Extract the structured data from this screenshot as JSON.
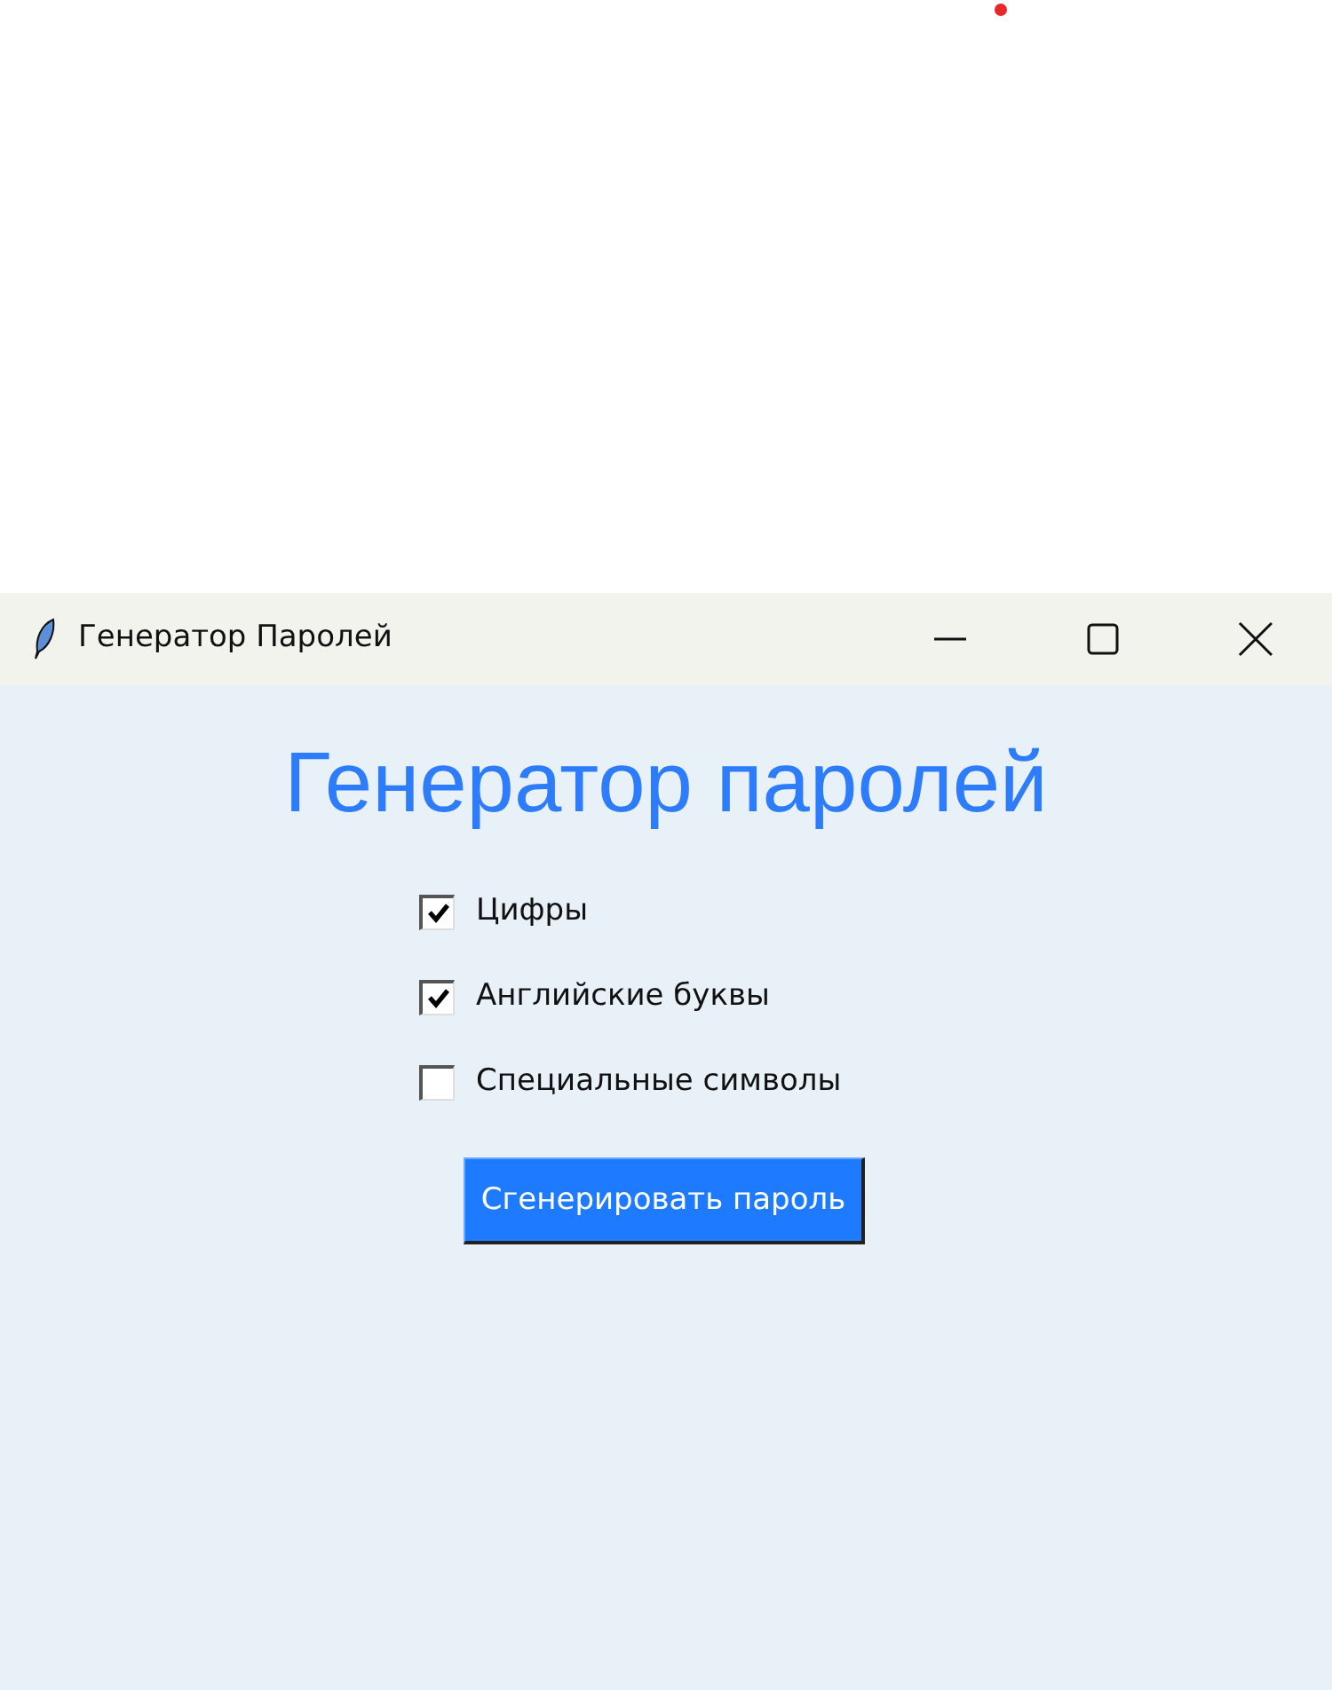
{
  "window": {
    "title": "Генератор Паролей"
  },
  "heading": "Генератор паролей",
  "options": [
    {
      "label": "Цифры",
      "checked": true
    },
    {
      "label": "Английские буквы",
      "checked": true
    },
    {
      "label": "Специальные символы",
      "checked": false
    }
  ],
  "button": "Сгенерировать пароль"
}
